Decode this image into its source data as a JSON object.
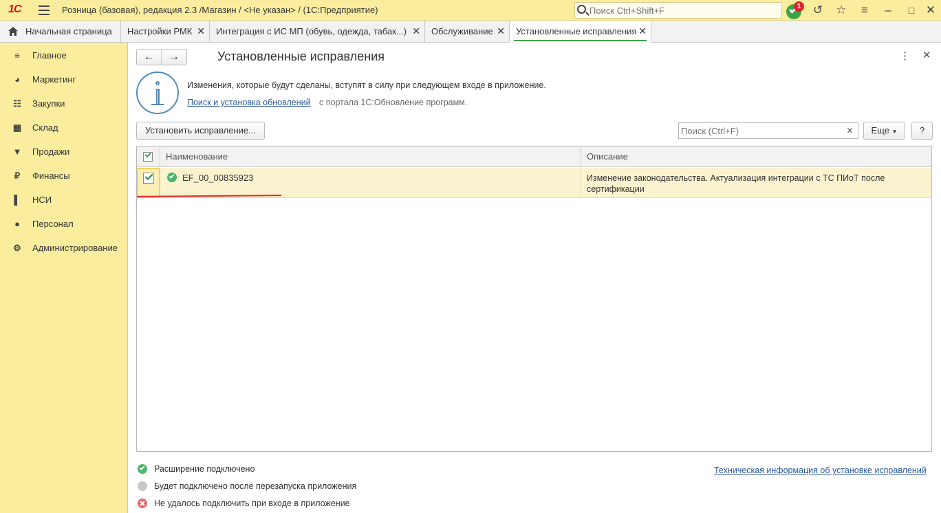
{
  "app": {
    "logo": "1С",
    "title": "Розница (базовая), редакция 2.3 /Магазин / <Не указан> /  (1С:Предприятие)",
    "search_placeholder": "Поиск Ctrl+Shift+F",
    "notification_count": "1"
  },
  "tabs": [
    {
      "label": "Начальная страница",
      "icon": "home-icon"
    },
    {
      "label": "Настройки РМК"
    },
    {
      "label": "Интеграция с ИС МП (обувь, одежда, табак...)"
    },
    {
      "label": "Обслуживание"
    },
    {
      "label": "Установленные исправления",
      "active": true
    }
  ],
  "sidebar": {
    "items": [
      {
        "label": "Главное",
        "icon": "menu-icon"
      },
      {
        "label": "Маркетинг",
        "icon": "pie-chart-icon"
      },
      {
        "label": "Закупки",
        "icon": "cart-icon"
      },
      {
        "label": "Склад",
        "icon": "warehouse-icon"
      },
      {
        "label": "Продажи",
        "icon": "shopping-basket-icon"
      },
      {
        "label": "Финансы",
        "icon": "ruble-icon"
      },
      {
        "label": "НСИ",
        "icon": "book-icon"
      },
      {
        "label": "Персонал",
        "icon": "person-icon"
      },
      {
        "label": "Администрирование",
        "icon": "gear-icon"
      }
    ]
  },
  "page": {
    "title": "Установленные исправления",
    "info_text": "Изменения, которые будут сделаны, вступят в силу при следующем входе в приложение.",
    "info_link": "Поиск и установка обновлений",
    "info_suffix": "с портала 1С:Обновление программ.",
    "install_button": "Установить исправление...",
    "search_placeholder": "Поиск (Ctrl+F)",
    "more_button": "Еще",
    "help_button": "?"
  },
  "table": {
    "columns": [
      "Наименование",
      "Описание"
    ],
    "rows": [
      {
        "checked": true,
        "status": "connected",
        "name": "EF_00_00835923",
        "description": "Изменение законодательства. Актуализация интеграции с ТС ПИоТ после сертификации"
      }
    ]
  },
  "legend": [
    {
      "label": "Расширение подключено",
      "color": "#49B66A"
    },
    {
      "label": "Будет подключено после перезапуска приложения",
      "color": "#C8C8C8"
    },
    {
      "label": "Не удалось подключить при входе в приложение",
      "color": "#E36B6B"
    }
  ],
  "tech_link": "Техническая информация об установке исправлений",
  "colors": {
    "accent_yellow": "#FBED9E",
    "accent_green": "#3BA445",
    "link_blue": "#2A57A0",
    "annotation_red": "#E8262B"
  }
}
